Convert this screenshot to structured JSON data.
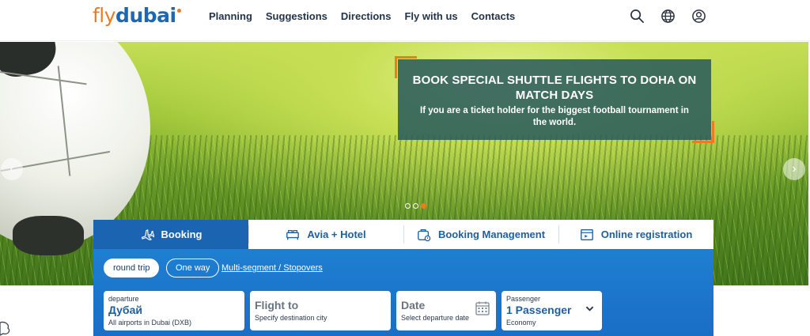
{
  "logo": {
    "part1": "fly",
    "part2": "dubai"
  },
  "nav": [
    "Planning",
    "Suggestions",
    "Directions",
    "Fly with us",
    "Contacts"
  ],
  "header_icons": [
    "search-icon",
    "globe-icon",
    "user-icon"
  ],
  "banner": {
    "title": "BOOK SPECIAL SHUTTLE FLIGHTS TO DOHA ON MATCH DAYS",
    "text": "If you are a ticket holder for the biggest football tournament in the world."
  },
  "carousel": {
    "slides": 3,
    "active_slide": 3
  },
  "tabs": [
    {
      "label": "Booking",
      "icon": "plane-icon"
    },
    {
      "label": "Avia + Hotel",
      "icon": "bed-icon"
    },
    {
      "label": "Booking Management",
      "icon": "suitcase-icon"
    },
    {
      "label": "Online registration",
      "icon": "boarding-pass-icon"
    }
  ],
  "trip": {
    "round_trip": "round trip",
    "one_way": "One way",
    "multi": "Multi-segment / Stopovers"
  },
  "fields": {
    "departure": {
      "label": "departure",
      "value": "Дубай",
      "sub": "All airports in Dubai (DXB)"
    },
    "destination": {
      "value": "Flight to",
      "sub": "Specify destination city"
    },
    "date": {
      "value": "Date",
      "sub": "Select departure date"
    },
    "passenger": {
      "label": "Passenger",
      "value": "1 Passenger",
      "sub": "Economy"
    }
  },
  "colors": {
    "brand_orange": "#f07b1f",
    "brand_blue": "#1a64b2",
    "banner_bg": "#2b5c5c"
  }
}
